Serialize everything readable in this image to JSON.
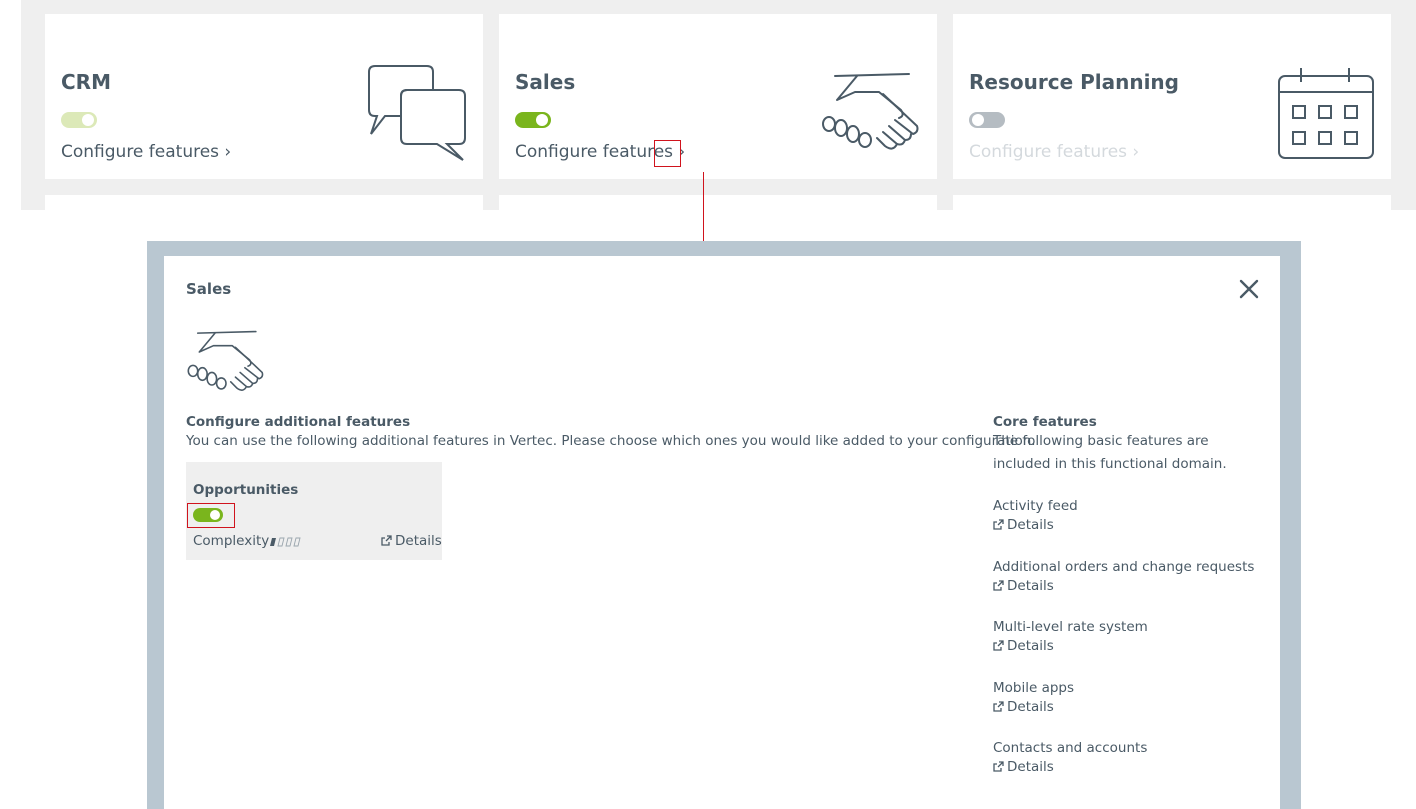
{
  "colors": {
    "accent": "#7ab51d",
    "annotation": "#d0131d",
    "modal_frame": "#b9c7d1",
    "text": "#4a5a66"
  },
  "cards": [
    {
      "title": "CRM",
      "toggle_state": "on-light",
      "configure_label": "Configure features",
      "icon": "speech-bubbles-icon"
    },
    {
      "title": "Sales",
      "toggle_state": "on",
      "configure_label": "Configure features",
      "icon": "handshake-icon"
    },
    {
      "title": "Resource Planning",
      "toggle_state": "off",
      "configure_label": "Configure features",
      "icon": "calendar-icon"
    }
  ],
  "modal": {
    "title": "Sales",
    "icon": "handshake-icon",
    "additional": {
      "title": "Configure additional features",
      "description": "You can use the following additional features in Vertec. Please choose which ones you would like added to your configuration."
    },
    "opportunity": {
      "title": "Opportunities",
      "toggle_state": "on",
      "complexity_label": "Complexity",
      "complexity_level": 1,
      "complexity_max": 4,
      "details_label": "Details"
    },
    "core": {
      "title": "Core features",
      "description": "The following basic features are included in this functional domain.",
      "details_label": "Details",
      "items": [
        {
          "name": "Activity feed"
        },
        {
          "name": "Additional orders and change requests"
        },
        {
          "name": "Multi-level rate system"
        },
        {
          "name": "Mobile apps"
        },
        {
          "name": "Contacts and accounts"
        }
      ]
    }
  }
}
